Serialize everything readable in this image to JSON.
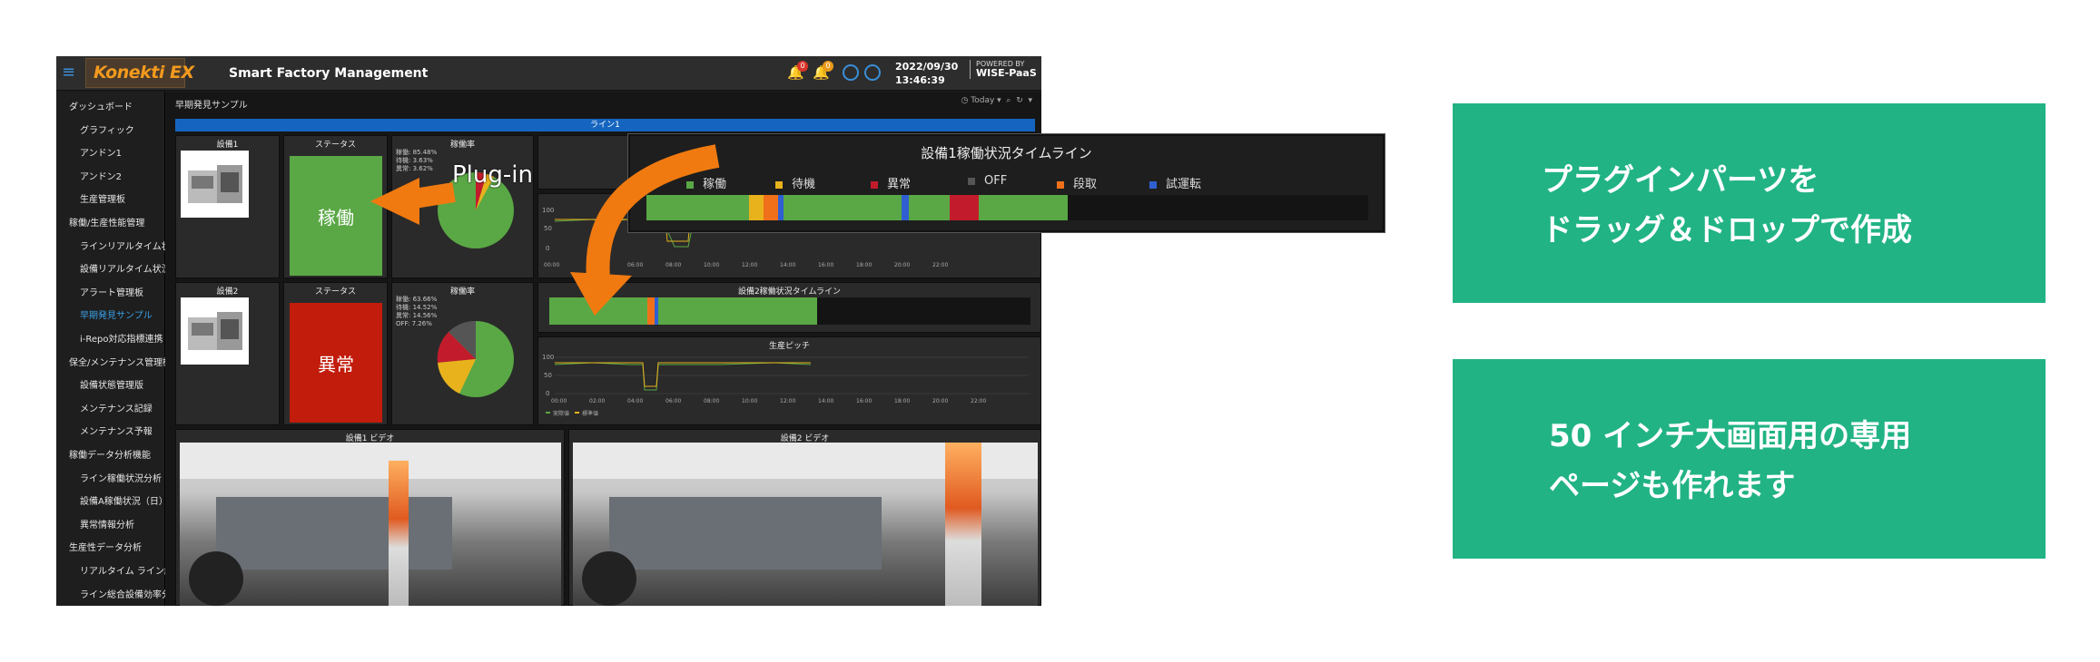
{
  "app": {
    "brand": "Konekti EX",
    "title": "Smart Factory Management",
    "date": "2022/09/30",
    "time": "13:46:39",
    "powered_by": "POWERED BY",
    "platform": "WISE-PaaS",
    "notif_badges": [
      "0",
      "0"
    ]
  },
  "sidebar": {
    "items": [
      {
        "label": "ダッシュボード",
        "level": 1
      },
      {
        "label": "グラフィック",
        "level": 2
      },
      {
        "label": "アンドン1",
        "level": 2
      },
      {
        "label": "アンドン2",
        "level": 2
      },
      {
        "label": "生産管理板",
        "level": 2
      },
      {
        "label": "稼働/生産性能管理",
        "level": 1
      },
      {
        "label": "ラインリアルタイム状況",
        "level": 2
      },
      {
        "label": "設備リアルタイム状況",
        "level": 2
      },
      {
        "label": "アラート管理板",
        "level": 2
      },
      {
        "label": "早期発見サンプル",
        "level": 2,
        "active": true
      },
      {
        "label": "i-Repo対応指標連携",
        "level": 2
      },
      {
        "label": "保全/メンテナンス管理機能",
        "level": 1
      },
      {
        "label": "設備状態管理版",
        "level": 2
      },
      {
        "label": "メンテナンス記録",
        "level": 2
      },
      {
        "label": "メンテナンス予報",
        "level": 2
      },
      {
        "label": "稼働データ分析機能",
        "level": 1
      },
      {
        "label": "ライン稼働状況分析",
        "level": 2
      },
      {
        "label": "設備A稼働状況（日）",
        "level": 2
      },
      {
        "label": "異常情報分析",
        "level": 2
      },
      {
        "label": "生産性データ分析",
        "level": 1
      },
      {
        "label": "リアルタイム ライン総合",
        "level": 2
      },
      {
        "label": "ライン総合設備効率分析",
        "level": 2
      }
    ]
  },
  "page": {
    "breadcrumb": "早期発見サンプル",
    "time_range": "Today",
    "line_label": "ライン1"
  },
  "device1": {
    "title": "設備1",
    "status_title": "ステータス",
    "status_value": "稼働",
    "status_color": "#5aa845",
    "rate_title": "稼働率",
    "legend": [
      "稼働: 85.48%",
      "待機: 3.63%",
      "異常: 3.62%"
    ]
  },
  "device2": {
    "title": "設備2",
    "status_title": "ステータス",
    "status_value": "異常",
    "status_color": "#c21c0c",
    "rate_title": "稼働率",
    "legend": [
      "稼働: 63.66%",
      "待機: 14.52%",
      "異常: 14.56%",
      "OFF: 7.26%"
    ],
    "timeline_title": "設備2稼働状況タイムライン",
    "pitch_title": "生産ピッチ"
  },
  "chart_axis": {
    "y_ticks": [
      "100",
      "50",
      "0"
    ],
    "x_ticks": [
      "00:00",
      "02:00",
      "04:00",
      "06:00",
      "08:00",
      "10:00",
      "12:00",
      "14:00",
      "16:00",
      "18:00",
      "20:00",
      "22:00"
    ],
    "legend": [
      "実際値",
      "標準値"
    ]
  },
  "videos": {
    "left": "設備1 ビデオ",
    "right": "設備2 ビデオ"
  },
  "popup": {
    "title": "設備1稼働状況タイムライン",
    "legend": [
      {
        "label": "稼働",
        "color": "#5aa845"
      },
      {
        "label": "待機",
        "color": "#e8b21c"
      },
      {
        "label": "異常",
        "color": "#c21c2c"
      },
      {
        "label": "OFF",
        "color": "#555555"
      },
      {
        "label": "段取",
        "color": "#f0701a"
      },
      {
        "label": "試運転",
        "color": "#2f5fd0"
      }
    ]
  },
  "annotation": {
    "plugin": "Plug-in"
  },
  "callouts": {
    "top": [
      "プラグインパーツを",
      "ドラッグ＆ドロップで作成"
    ],
    "bottom": [
      "50 インチ大画面用の専用",
      "ページも作れます"
    ]
  }
}
